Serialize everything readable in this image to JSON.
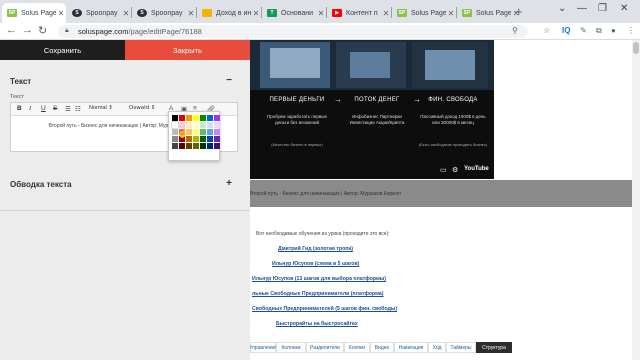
{
  "browser": {
    "tabs": [
      {
        "label": "Solus Page",
        "favicon": "solus-favicon",
        "color": "#8bc34a",
        "active": true
      },
      {
        "label": "Spoonpay",
        "favicon": "spoonpay-favicon",
        "color": "#263238",
        "active": false
      },
      {
        "label": "Spoonpay",
        "favicon": "spoonpay-favicon",
        "color": "#263238",
        "active": false
      },
      {
        "label": "Доход в ин",
        "favicon": "docs-favicon",
        "color": "#f4b400",
        "active": false
      },
      {
        "label": "Основани",
        "favicon": "sheets-favicon",
        "color": "#0f9d58",
        "active": false
      },
      {
        "label": "Контент п",
        "favicon": "youtube-favicon",
        "color": "#ff0000",
        "active": false
      },
      {
        "label": "Solus Page",
        "favicon": "solus-favicon",
        "color": "#8bc34a",
        "active": false
      },
      {
        "label": "Solus Page",
        "favicon": "solus-favicon",
        "color": "#8bc34a",
        "active": false
      }
    ],
    "url_host": "soluspage.com",
    "url_path": "/page/editPage/76188"
  },
  "editor": {
    "save_label": "Сохранить",
    "close_label": "Закрыть",
    "text_section_title": "Текст",
    "text_section_toggle": "−",
    "text_sublabel": "Текст",
    "toolbar": {
      "bold": "B",
      "italic": "I",
      "underline": "U",
      "strike": "S",
      "list": "☰",
      "format_select": "Normal",
      "font_select": "Oswald"
    },
    "editor_content": "Второй путь - Бизнес для начинающих | Автор: Мурзаков Кирилл",
    "border_section_title": "Обводка текста",
    "border_section_toggle": "+",
    "palette_colors": [
      "#000000",
      "#e60000",
      "#ff9900",
      "#ffff00",
      "#008a00",
      "#0066cc",
      "#9933ff",
      "#ffffff",
      "#facccc",
      "#ffebcc",
      "#ffffcc",
      "#cce8cc",
      "#cce0f5",
      "#ebd6ff",
      "#bbbbbb",
      "#f06666",
      "#ffc266",
      "#ffff66",
      "#66b966",
      "#66a3e0",
      "#c285ff",
      "#888888",
      "#a10000",
      "#b26b00",
      "#b2b200",
      "#006100",
      "#0047b2",
      "#6b24b2",
      "#444444",
      "#5c0000",
      "#663d00",
      "#666600",
      "#003700",
      "#002966",
      "#3d1466"
    ]
  },
  "video": {
    "steps": [
      "ПЕРВЫЕ ДЕНЬГИ",
      "ПОТОК ДЕНЕГ",
      "ФИН. СВОБОДА"
    ],
    "descs": [
      "Пробуем заработать первые деньги без вложений",
      "Инфобизнес Партнерки Инвестиции Акции/Крипта",
      "Пассивный доход 1000$ в день или 30000$ в месяц"
    ],
    "notes": [
      "(Качество бизнес в первых)",
      "",
      "(Быть свободным проводить бизнес)"
    ],
    "yt_label": "YouTube"
  },
  "page": {
    "gray_caption": "Второй путь - Бизнес для начинающих | Автор: Мурзаков Кирилл",
    "links_intro": "Вот необходимые обучения из урока (проходите это все):",
    "links": [
      "Дмитрий Гид (золотая тропа)",
      "Ильнур Юсупов (схема в 5 шагов)",
      "Ильнур Юсупов (13 шагов для выбора платформы)",
      "льные Свободные Предприниматели (платформа)",
      "Свободных Предпринимателей (5 шагов фин. свободы)",
      "Быстрорайты на быстросайтах"
    ],
    "nav": [
      "Управления",
      "Колонки",
      "Разделители",
      "Кнопки",
      "Видео",
      "Навигация",
      "Ход",
      "Таймеры",
      "Структура"
    ],
    "nav_active": "Структура"
  }
}
